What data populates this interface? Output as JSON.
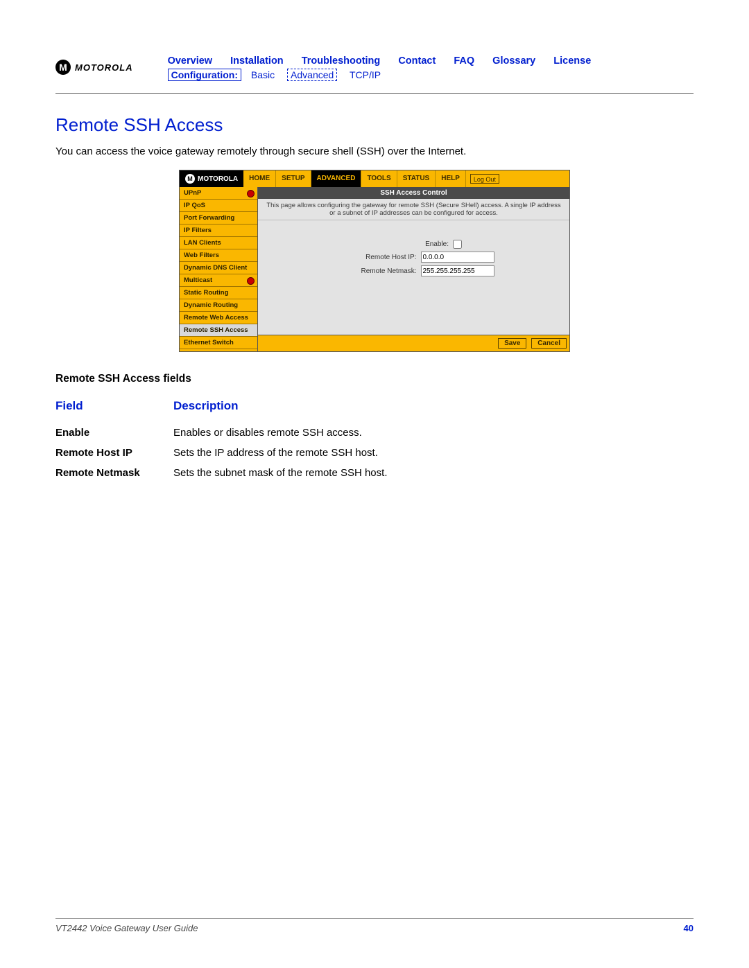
{
  "logo_text": "MOTOROLA",
  "nav_top": [
    "Overview",
    "Installation",
    "Troubleshooting",
    "Contact",
    "FAQ",
    "Glossary",
    "License"
  ],
  "nav_sub_label": "Configuration:",
  "nav_sub": [
    "Basic",
    "Advanced",
    "TCP/IP"
  ],
  "section_title": "Remote SSH Access",
  "intro": "You can access the voice gateway remotely through secure shell (SSH) over the Internet.",
  "panel": {
    "logo": "MOTOROLA",
    "tabs": [
      "HOME",
      "SETUP",
      "ADVANCED",
      "TOOLS",
      "STATUS",
      "HELP"
    ],
    "active_tab": "ADVANCED",
    "logout": "Log Out",
    "side": [
      "UPnP",
      "IP QoS",
      "Port Forwarding",
      "IP Filters",
      "LAN Clients",
      "Web Filters",
      "Dynamic DNS Client",
      "Multicast",
      "Static Routing",
      "Dynamic Routing",
      "Remote Web Access",
      "Remote SSH Access",
      "Ethernet Switch"
    ],
    "side_selected": "Remote SSH Access",
    "side_dots": [
      "UPnP",
      "Multicast"
    ],
    "title": "SSH Access Control",
    "desc": "This page allows configuring the gateway for remote SSH (Secure SHell) access. A single IP address or a subnet of IP addresses can be configured for access.",
    "fields": {
      "enable_label": "Enable:",
      "host_label": "Remote Host IP:",
      "host_value": "0.0.0.0",
      "mask_label": "Remote Netmask:",
      "mask_value": "255.255.255.255"
    },
    "save": "Save",
    "cancel": "Cancel"
  },
  "fields_heading": "Remote SSH Access fields",
  "th_field": "Field",
  "th_desc": "Description",
  "rows": [
    {
      "f": "Enable",
      "d": "Enables or disables remote SSH access."
    },
    {
      "f": "Remote Host IP",
      "d": "Sets the IP address of the remote SSH host."
    },
    {
      "f": "Remote Netmask",
      "d": "Sets the subnet mask of the remote SSH host."
    }
  ],
  "footer_left": "VT2442 Voice Gateway User Guide",
  "footer_right": "40"
}
